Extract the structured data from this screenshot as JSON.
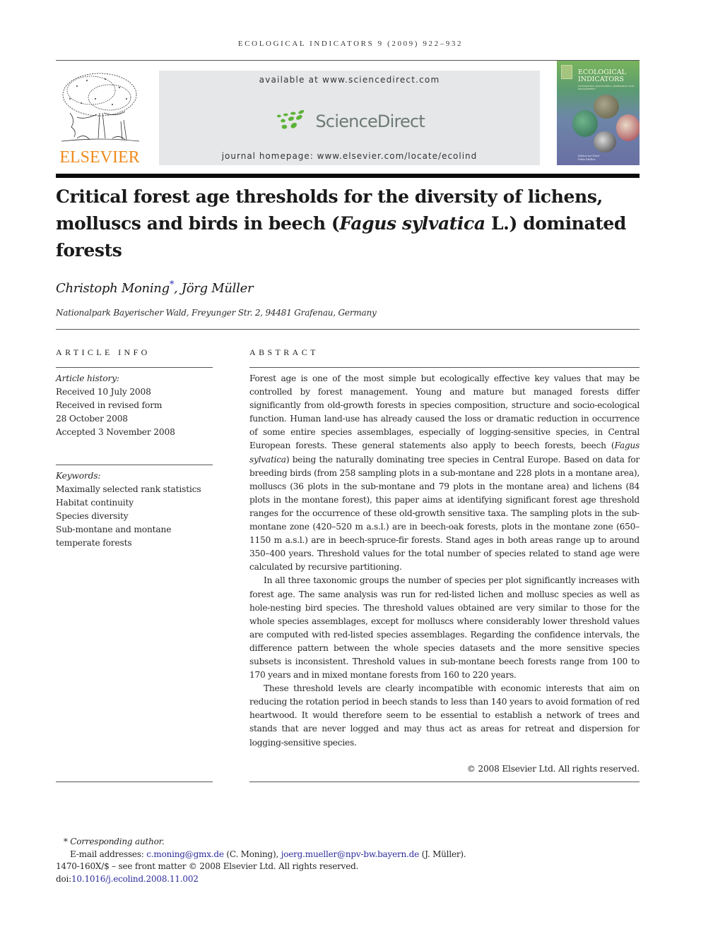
{
  "running_head": "ECOLOGICAL INDICATORS 9 (2009) 922–932",
  "publisher": {
    "name": "ELSEVIER",
    "logo_icon": "elsevier-tree-icon",
    "brand_color": "#f08a1c"
  },
  "sciencedirect_banner": {
    "available_at": "available at www.sciencedirect.com",
    "logo_text": "ScienceDirect",
    "logo_icon": "sciencedirect-dots-icon",
    "logo_color": "#6d7a74",
    "dots_color": "#5cb33a",
    "homepage": "journal homepage: www.elsevier.com/locate/ecolind",
    "background": "#e6e7e8"
  },
  "journal_cover": {
    "title_line1": "ECOLOGICAL",
    "title_line2": "INDICATORS",
    "subtitle": "INTEGRATING, MONITORING, ASSESSMENT AND MANAGEMENT",
    "editor_label": "Editor-in-Chief",
    "editor_name": "Felix Müller"
  },
  "article": {
    "title_part1": "Critical forest age thresholds for the diversity of lichens, molluscs and birds in beech (",
    "title_italic": "Fagus sylvatica",
    "title_part2": " L.) dominated forests",
    "authors": {
      "author1": "Christoph Moning",
      "author1_mark": "*",
      "separator": ", ",
      "author2": "Jörg Müller"
    },
    "affiliation": "Nationalpark Bayerischer Wald, Freyunger Str. 2, 94481 Grafenau, Germany"
  },
  "article_info": {
    "heading": "ARTICLE INFO",
    "history_label": "Article history:",
    "history": [
      "Received 10 July 2008",
      "Received in revised form",
      "28 October 2008",
      "Accepted 3 November 2008"
    ],
    "keywords_label": "Keywords:",
    "keywords": [
      "Maximally selected rank statistics",
      "Habitat continuity",
      "Species diversity",
      "Sub-montane and montane",
      "temperate forests"
    ]
  },
  "abstract": {
    "heading": "ABSTRACT",
    "p1_a": "Forest age is one of the most simple but ecologically effective key values that may be controlled by forest management. Young and mature but managed forests differ significantly from old-growth forests in species composition, structure and socio-ecological function. Human land-use has already caused the loss or dramatic reduction in occurrence of some entire species assemblages, especially of logging-sensitive species, in Central European forests. These general statements also apply to beech forests, beech (",
    "p1_italic": "Fagus sylvatica",
    "p1_b": ") being the naturally dominating tree species in Central Europe. Based on data for breeding birds (from 258 sampling plots in a sub-montane and 228 plots in a montane area), molluscs (36 plots in the sub-montane and 79 plots in the montane area) and lichens (84 plots in the montane forest), this paper aims at identifying significant forest age threshold ranges for the occurrence of these old-growth sensitive taxa. The sampling plots in the sub-montane zone (420–520 m a.s.l.) are in beech-oak forests, plots in the montane zone (650–1150 m a.s.l.) are in beech-spruce-fir forests. Stand ages in both areas range up to around 350–400 years. Threshold values for the total number of species related to stand age were calculated by recursive partitioning.",
    "p2": "In all three taxonomic groups the number of species per plot significantly increases with forest age. The same analysis was run for red-listed lichen and mollusc species as well as hole-nesting bird species. The threshold values obtained are very similar to those for the whole species assemblages, except for molluscs where considerably lower threshold values are computed with red-listed species assemblages. Regarding the confidence intervals, the difference pattern between the whole species datasets and the more sensitive species subsets is inconsistent. Threshold values in sub-montane beech forests range from 100 to 170 years and in mixed montane forests from 160 to 220 years.",
    "p3": "These threshold levels are clearly incompatible with economic interests that aim on reducing the rotation period in beech stands to less than 140 years to avoid formation of red heartwood. It would therefore seem to be essential to establish a network of trees and stands that are never logged and may thus act as areas for retreat and dispersion for logging-sensitive species.",
    "copyright": "© 2008 Elsevier Ltd. All rights reserved."
  },
  "footnotes": {
    "corresponding_mark": "*",
    "corresponding_label": "Corresponding author.",
    "email_label": "E-mail addresses: ",
    "email1": "c.moning@gmx.de",
    "email1_owner": " (C. Moning), ",
    "email2": "joerg.mueller@npv-bw.bayern.de",
    "email2_owner": " (J. Müller).",
    "issn_line": "1470-160X/$ – see front matter © 2008 Elsevier Ltd. All rights reserved.",
    "doi_label": "doi:",
    "doi": "10.1016/j.ecolind.2008.11.002",
    "link_color": "#2c2c9c"
  }
}
